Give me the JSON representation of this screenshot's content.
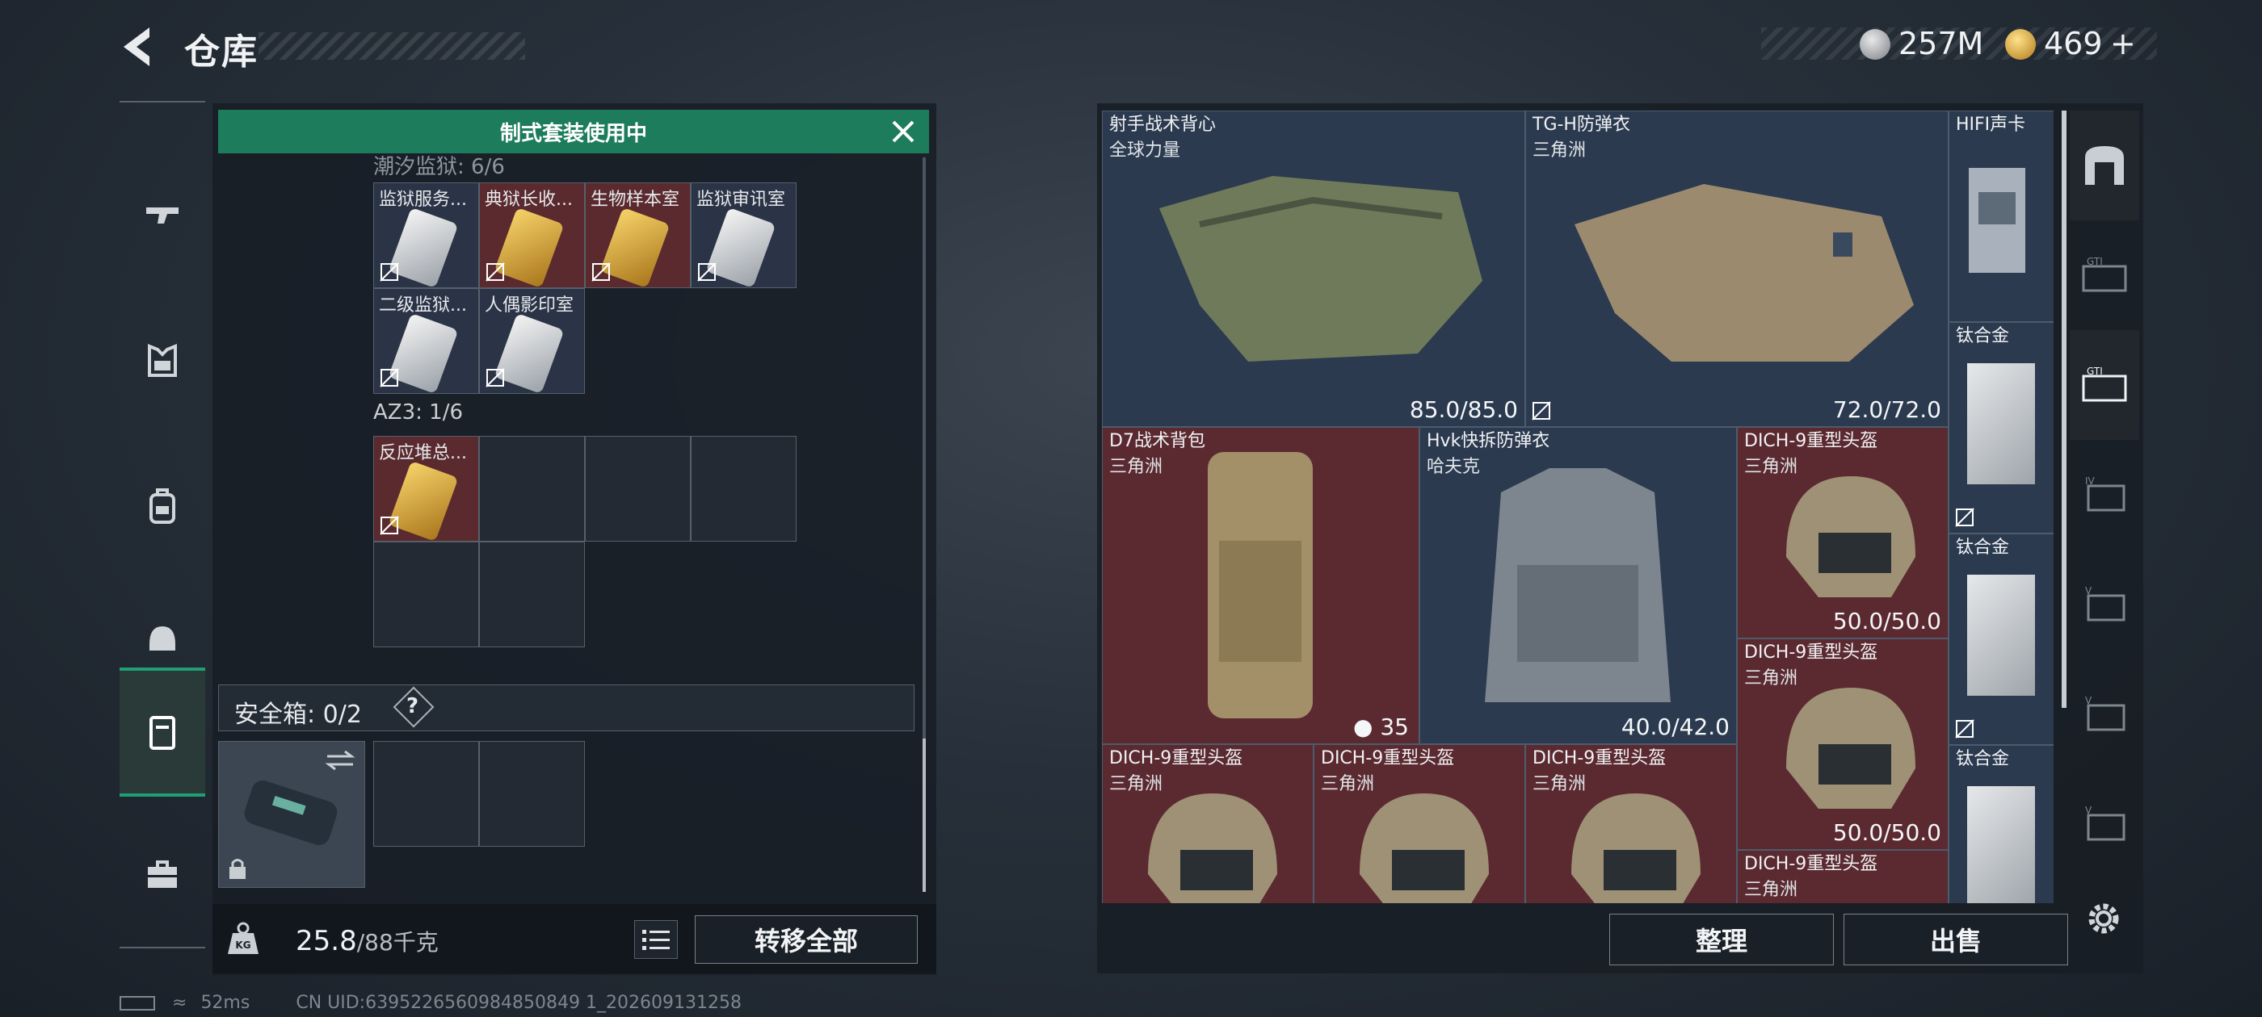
{
  "header": {
    "title": "仓库",
    "currency_silver": "257M",
    "currency_gold": "469",
    "add_symbol": "+"
  },
  "left_panel": {
    "banner": "制式套装使用中",
    "partial_header": "潮汐监狱: 6/6",
    "keycards": [
      {
        "label": "监狱服务...",
        "color": "silver"
      },
      {
        "label": "典狱长收...",
        "color": "gold"
      },
      {
        "label": "生物样本室",
        "color": "gold"
      },
      {
        "label": "监狱审讯室",
        "color": "silver"
      },
      {
        "label": "二级监狱...",
        "color": "silver"
      },
      {
        "label": "人偶影印室",
        "color": "silver"
      }
    ],
    "az3_label": "AZ3: 1/6",
    "az3_items": [
      {
        "label": "反应堆总...",
        "color": "gold"
      }
    ],
    "safe_box_label": "安全箱: 0/2",
    "help": "?",
    "weight_value": "25.8",
    "weight_max": "/88千克",
    "transfer_all": "转移全部"
  },
  "stash": {
    "items": [
      {
        "name": "射手战术背心",
        "origin": "全球力量",
        "durability": "85.0/85.0"
      },
      {
        "name": "TG-H防弹衣",
        "origin": "三角洲",
        "durability": "72.0/72.0"
      },
      {
        "name": "HIFI声卡",
        "origin": "",
        "durability": ""
      },
      {
        "name": "钛合金",
        "origin": "",
        "durability": ""
      },
      {
        "name": "D7战术背包",
        "origin": "三角洲",
        "count": "35"
      },
      {
        "name": "Hvk快拆防弹衣",
        "origin": "哈夫克",
        "durability": "40.0/42.0"
      },
      {
        "name": "DICH-9重型头盔",
        "origin": "三角洲",
        "durability": "50.0/50.0"
      },
      {
        "name": "钛合金",
        "origin": "",
        "durability": ""
      },
      {
        "name": "DICH-9重型头盔",
        "origin": "三角洲",
        "durability": "50.0/50.0"
      },
      {
        "name": "DICH-9重型头盔",
        "origin": "三角洲",
        "durability": ""
      },
      {
        "name": "DICH-9重型头盔",
        "origin": "三角洲",
        "durability": ""
      },
      {
        "name": "DICH-9重型头盔",
        "origin": "三角洲",
        "durability": ""
      },
      {
        "name": "钛合金",
        "origin": "",
        "durability": ""
      },
      {
        "name": "DICH-9重型头盔",
        "origin": "三角洲",
        "durability": ""
      }
    ],
    "sort_button": "整理",
    "sell_button": "出售"
  },
  "footer": {
    "ping": "52ms",
    "uid": "CN UID:6395226560984850849 1_202609131258"
  },
  "colors": {
    "accent_green": "#1c7c5b",
    "rarity_red": "#5b2a30",
    "rarity_blue": "#2b3a4f"
  },
  "icons": [
    "back-arrow-icon",
    "silver-coin-icon",
    "gold-coin-icon",
    "gun-icon",
    "armor-icon",
    "backpack-icon",
    "helmet-icon",
    "container-icon",
    "toolbox-icon",
    "close-icon",
    "help-icon",
    "lock-icon",
    "weight-icon",
    "list-icon",
    "gear-icon"
  ]
}
